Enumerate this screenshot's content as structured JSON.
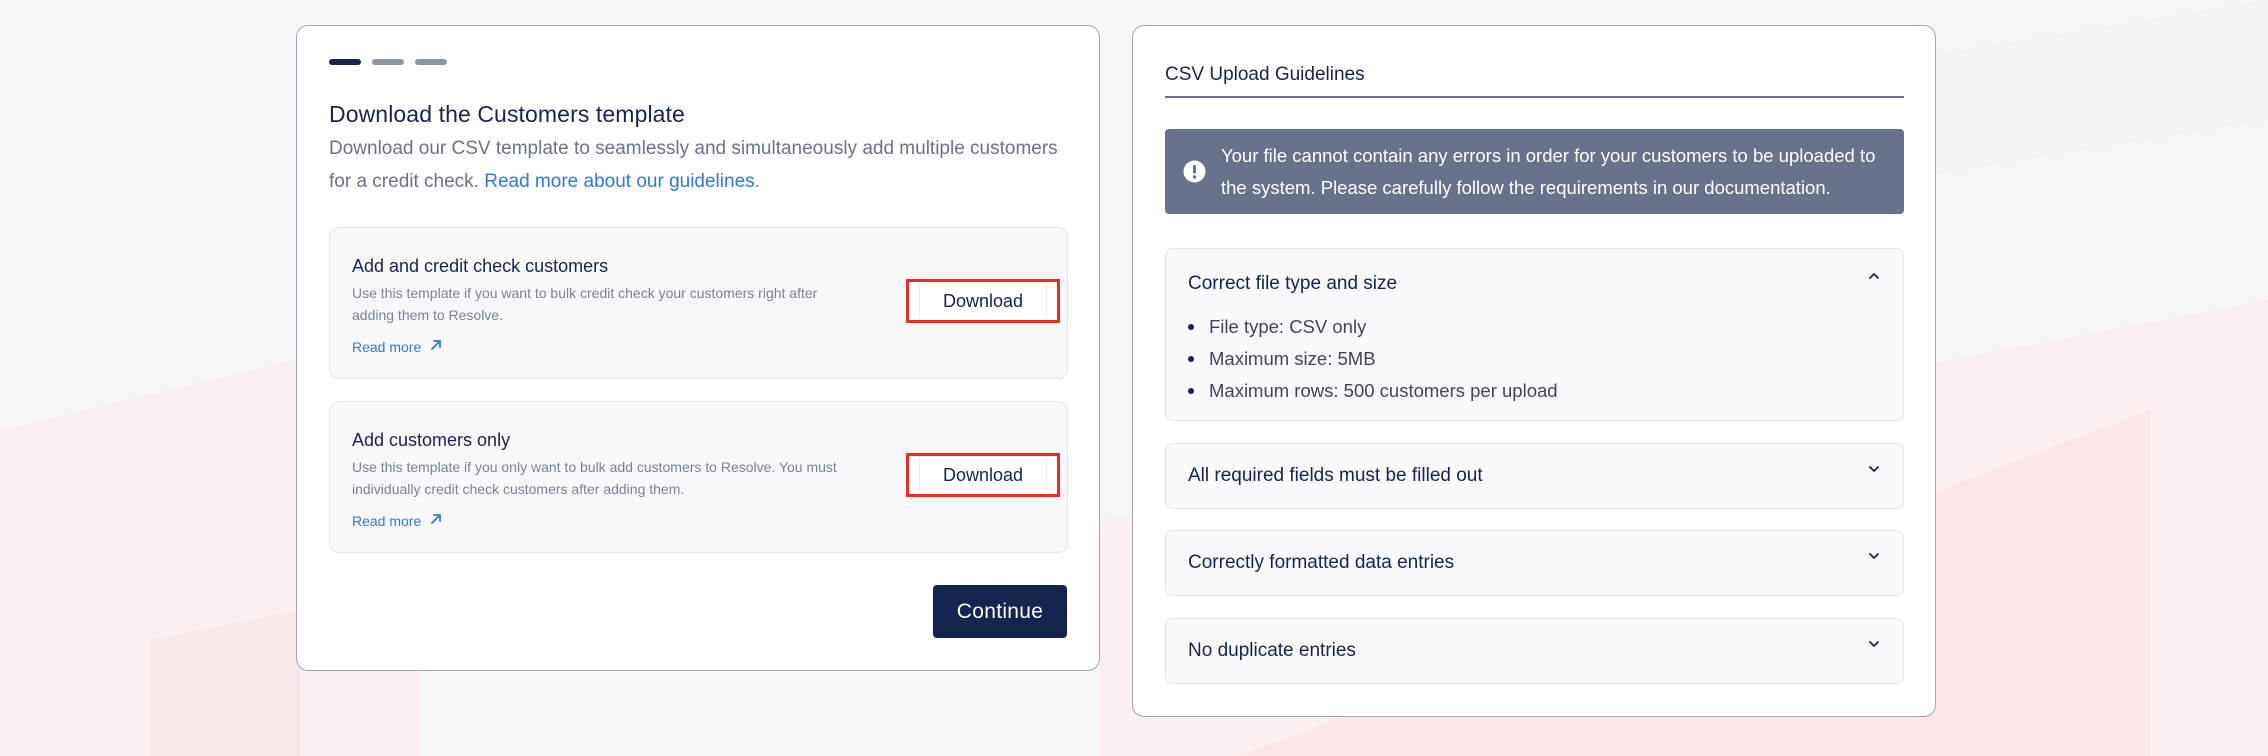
{
  "stepper": {
    "steps": [
      "step-1",
      "step-2",
      "step-3"
    ],
    "active_index": 0
  },
  "left": {
    "title": "Download the Customers template",
    "description": "Download our CSV template to seamlessly and simultaneously add multiple customers for a credit check.",
    "guidelines_link": "Read more about our guidelines.",
    "cards": [
      {
        "title": "Add and credit check customers",
        "description": "Use this template if you want to bulk credit check your customers right after adding them to Resolve.",
        "read_more": "Read more",
        "button": "Download"
      },
      {
        "title": "Add customers only",
        "description": "Use this template if you only want to bulk add customers to Resolve. You must individually credit check customers after adding them.",
        "read_more": "Read more",
        "button": "Download"
      }
    ],
    "continue_label": "Continue"
  },
  "right": {
    "title": "CSV Upload Guidelines",
    "alert": "Your file cannot contain any errors in order for your customers to be uploaded to the system. Please carefully follow the requirements in our documentation.",
    "accordions": [
      {
        "title": "Correct file type and size",
        "expanded": true,
        "items": [
          "File type: CSV only",
          "Maximum size: 5MB",
          "Maximum rows: 500 customers per upload"
        ]
      },
      {
        "title": "All required fields must be filled out",
        "expanded": false
      },
      {
        "title": "Correctly formatted data entries",
        "expanded": false
      },
      {
        "title": "No duplicate entries",
        "expanded": false
      }
    ]
  },
  "colors": {
    "navy": "#15254f",
    "link_blue": "#2e7ad6",
    "alert_bg": "#68728a",
    "highlight_red": "#e8301c"
  },
  "icons": {
    "alert": "exclamation-circle-icon",
    "read_more": "arrow-up-right-icon",
    "chevron_up": "chevron-up-icon",
    "chevron_down": "chevron-down-icon"
  }
}
